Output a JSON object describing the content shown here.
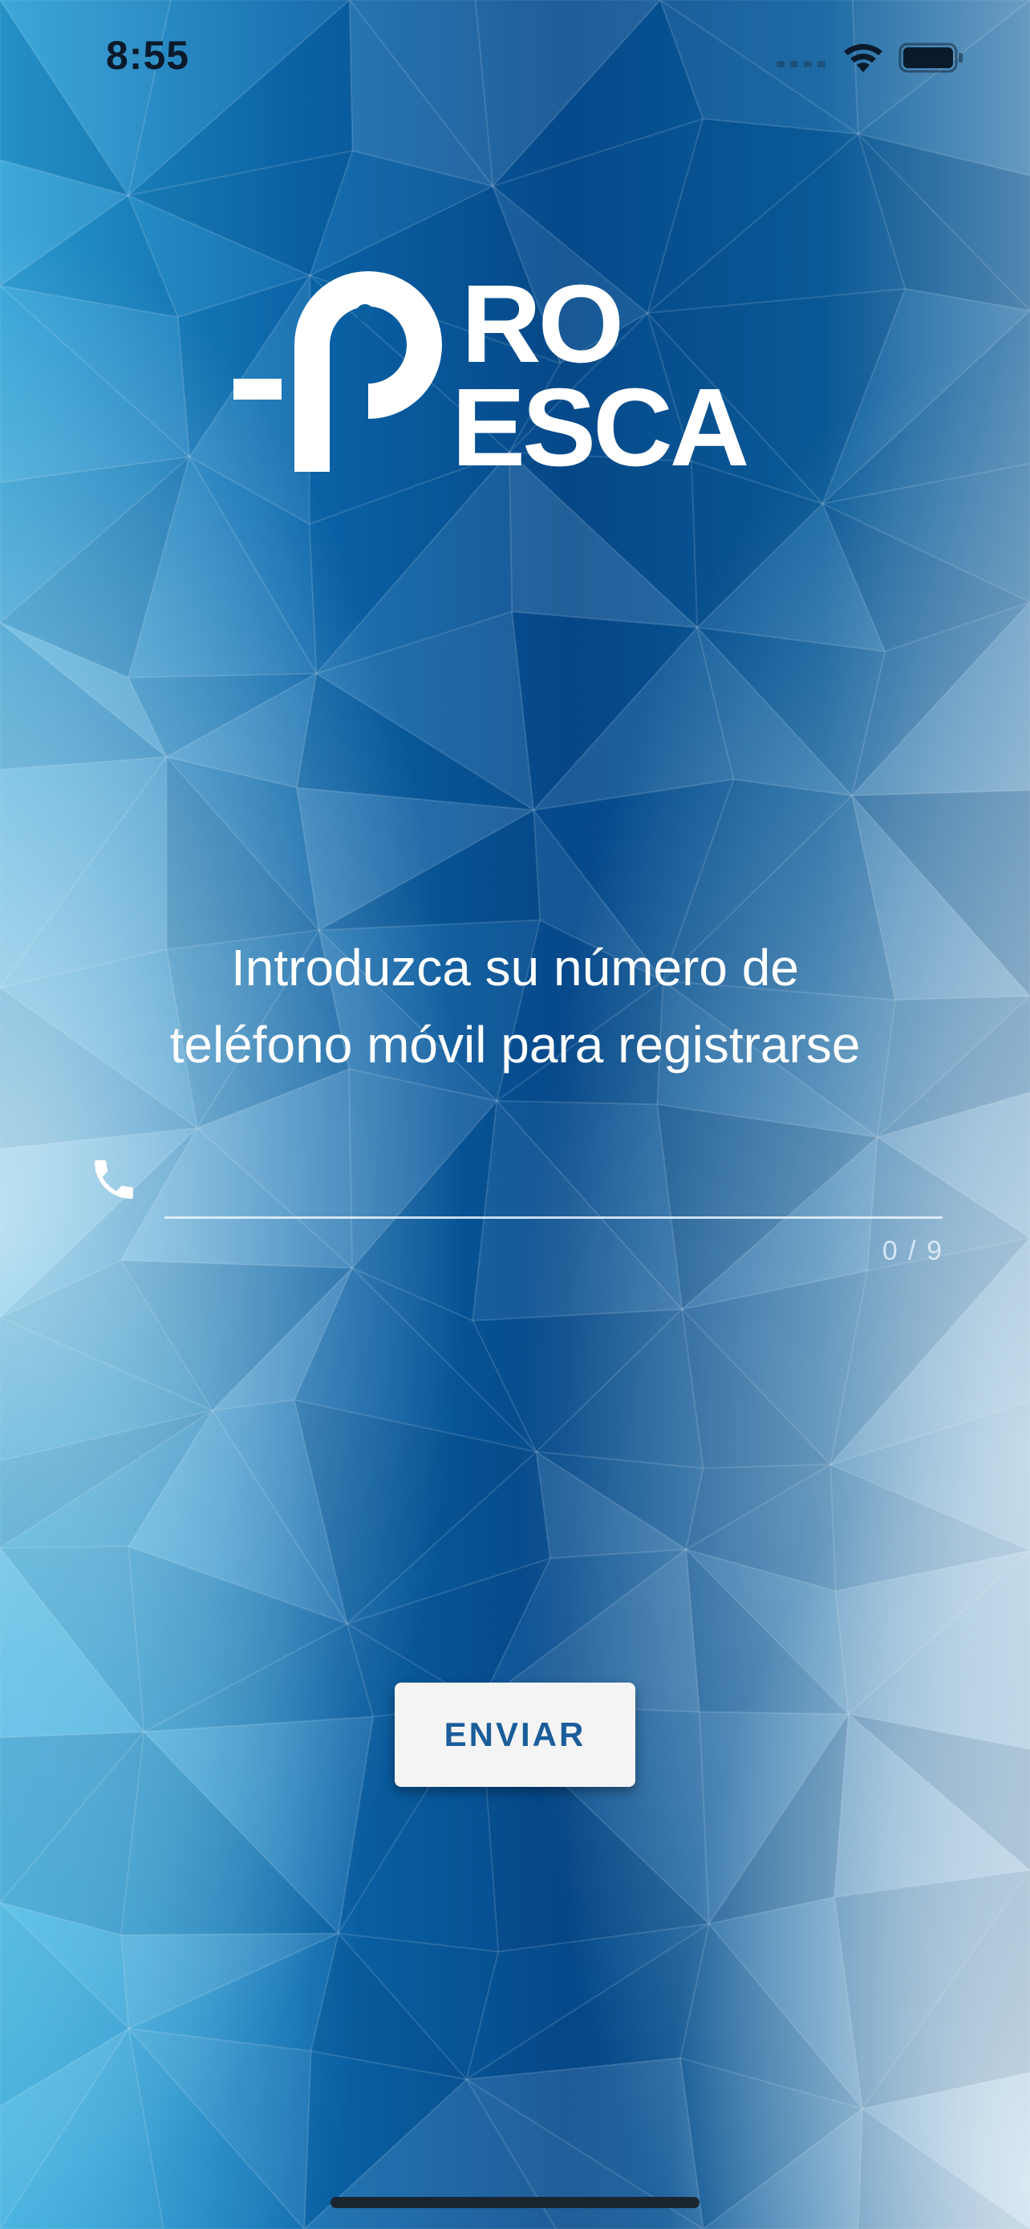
{
  "status_bar": {
    "time": "8:55",
    "icons": [
      "signal-icon",
      "wifi-icon",
      "battery-icon"
    ]
  },
  "brand": {
    "logo_text_line1": "RO",
    "logo_text_line2": "ESCA",
    "logo_letter": "P",
    "logo_color": "#ffffff"
  },
  "registration": {
    "instruction_line1": "Introduzca su número de",
    "instruction_line2": "teléfono móvil para registrarse",
    "phone_icon": "phone-icon",
    "phone_value": "",
    "phone_placeholder": "",
    "counter": "0 / 9",
    "submit_label": "ENVIAR"
  },
  "colors": {
    "accent": "#1a5d9a",
    "background_deep": "#0a4e8f",
    "background_light": "#a9d3ea",
    "button_bg": "#f4f4f4"
  }
}
